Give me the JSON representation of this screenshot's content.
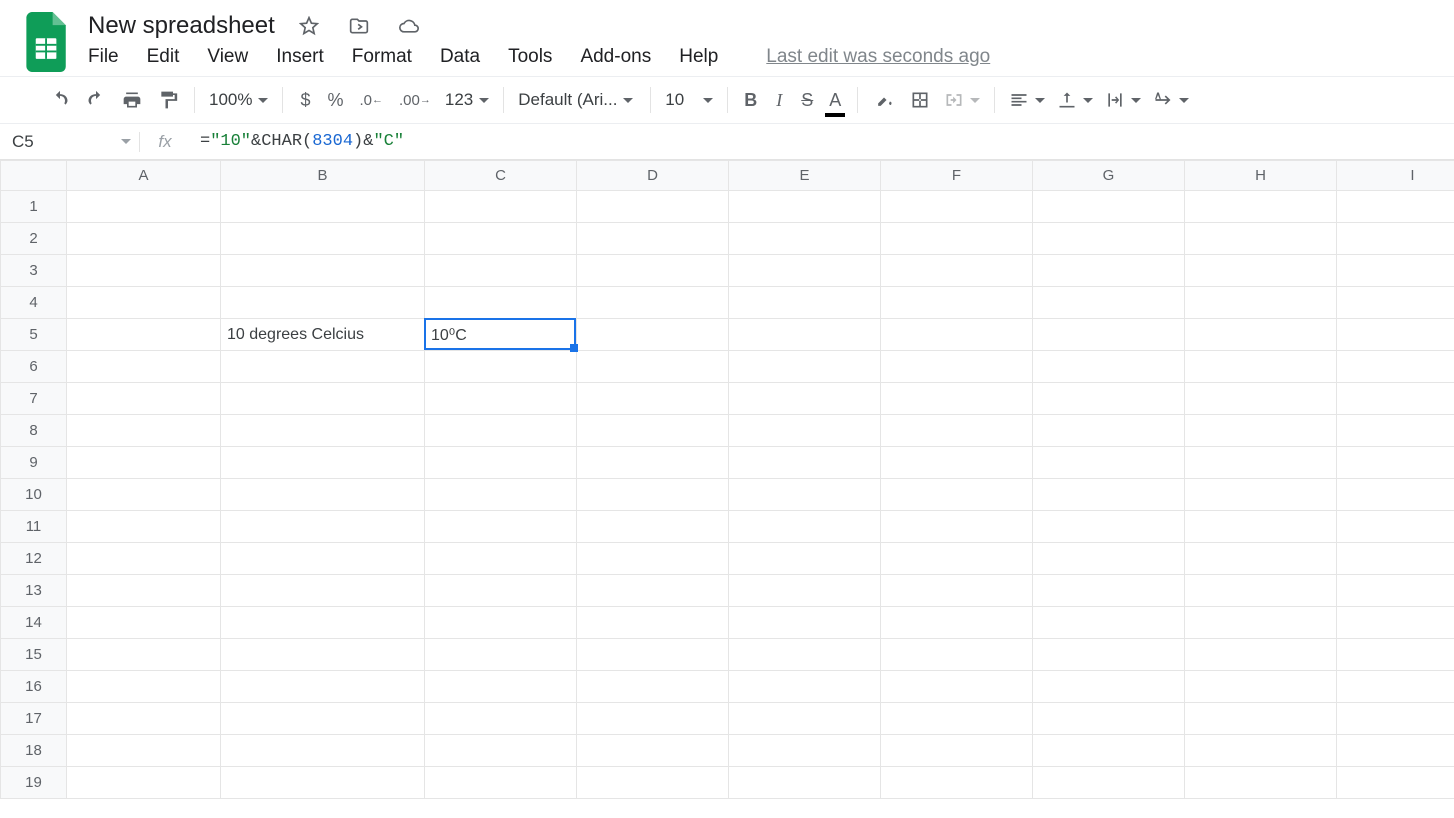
{
  "header": {
    "doc_title": "New spreadsheet",
    "last_edit": "Last edit was seconds ago"
  },
  "menus": [
    "File",
    "Edit",
    "View",
    "Insert",
    "Format",
    "Data",
    "Tools",
    "Add-ons",
    "Help"
  ],
  "toolbar": {
    "zoom": "100%",
    "font": "Default (Ari...",
    "font_size": "10",
    "number_format_more": "123"
  },
  "name_box": "C5",
  "formula_bar": {
    "raw": "=\"10\"&CHAR(8304)&\"C\"",
    "segments": [
      {
        "t": "=",
        "c": "func"
      },
      {
        "t": "\"10\"",
        "c": "str"
      },
      {
        "t": "&",
        "c": "func"
      },
      {
        "t": "CHAR",
        "c": "func"
      },
      {
        "t": "(",
        "c": "func"
      },
      {
        "t": "8304",
        "c": "num"
      },
      {
        "t": ")",
        "c": "func"
      },
      {
        "t": "&",
        "c": "func"
      },
      {
        "t": "\"C\"",
        "c": "str"
      }
    ]
  },
  "columns": [
    "A",
    "B",
    "C",
    "D",
    "E",
    "F",
    "G",
    "H",
    "I"
  ],
  "rows": [
    "1",
    "2",
    "3",
    "4",
    "5",
    "6",
    "7",
    "8",
    "9",
    "10",
    "11",
    "12",
    "13",
    "14",
    "15",
    "16",
    "17",
    "18",
    "19"
  ],
  "active_cell": {
    "col": "C",
    "row": "5"
  },
  "cells": {
    "B5": "10 degrees Celcius",
    "C5": "10⁰C"
  },
  "icons": {
    "star": "star-outline-icon",
    "move": "move-to-folder-icon",
    "cloud": "cloud-status-icon"
  }
}
